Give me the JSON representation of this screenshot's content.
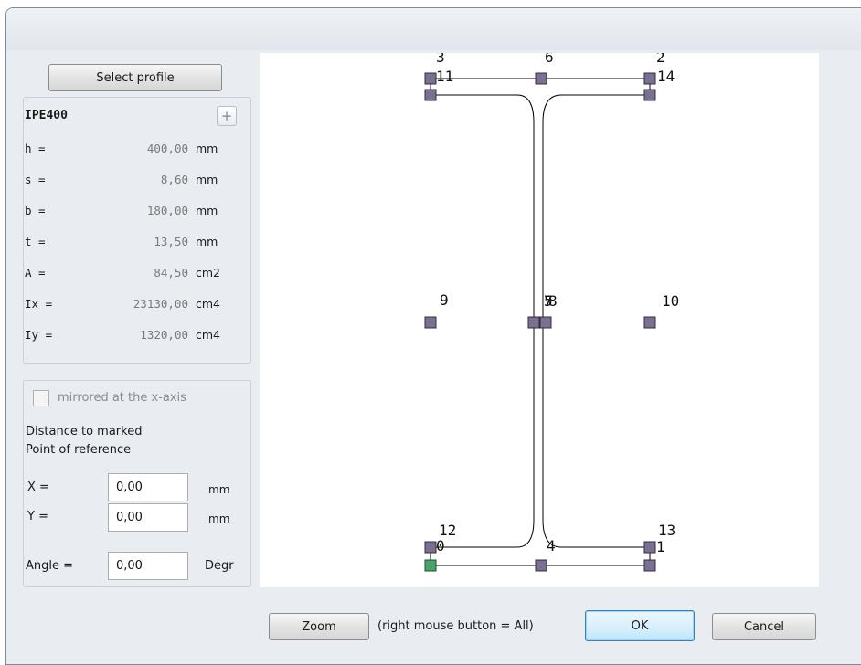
{
  "dialog": {
    "select_profile_label": "Select profile",
    "profile_name": "IPE400",
    "add_icon_glyph": "+",
    "properties": [
      {
        "name": "h =",
        "value": "400,00",
        "unit": "mm"
      },
      {
        "name": "s =",
        "value": "8,60",
        "unit": "mm"
      },
      {
        "name": "b =",
        "value": "180,00",
        "unit": "mm"
      },
      {
        "name": "t =",
        "value": "13,50",
        "unit": "mm"
      },
      {
        "name": "A =",
        "value": "84,50",
        "unit": "cm2"
      },
      {
        "name": "Ix =",
        "value": "23130,00",
        "unit": "cm4"
      },
      {
        "name": "Iy =",
        "value": "1320,00",
        "unit": "cm4"
      }
    ],
    "mirror_label": "mirrored at the x-axis",
    "mirror_checked": false,
    "distance_label_line1": "Distance to marked",
    "distance_label_line2": "Point of reference",
    "x_label": "X =",
    "x_value": "0,00",
    "x_unit": "mm",
    "y_label": "Y =",
    "y_value": "0,00",
    "y_unit": "mm",
    "angle_label": "Angle =",
    "angle_value": "0,00",
    "angle_unit": "Degr",
    "zoom_label": "Zoom",
    "zoom_hint": "(right mouse button = All)",
    "ok_label": "OK",
    "cancel_label": "Cancel"
  },
  "preview": {
    "point_labels": [
      "0",
      "1",
      "2",
      "3",
      "4",
      "5",
      "6",
      "7",
      "8",
      "9",
      "10",
      "11",
      "12",
      "13",
      "14"
    ],
    "reference_point": "0"
  },
  "colors": {
    "node_fill": "#7b6f93",
    "reference_node_fill": "#4aa36b",
    "outline": "#000000"
  }
}
